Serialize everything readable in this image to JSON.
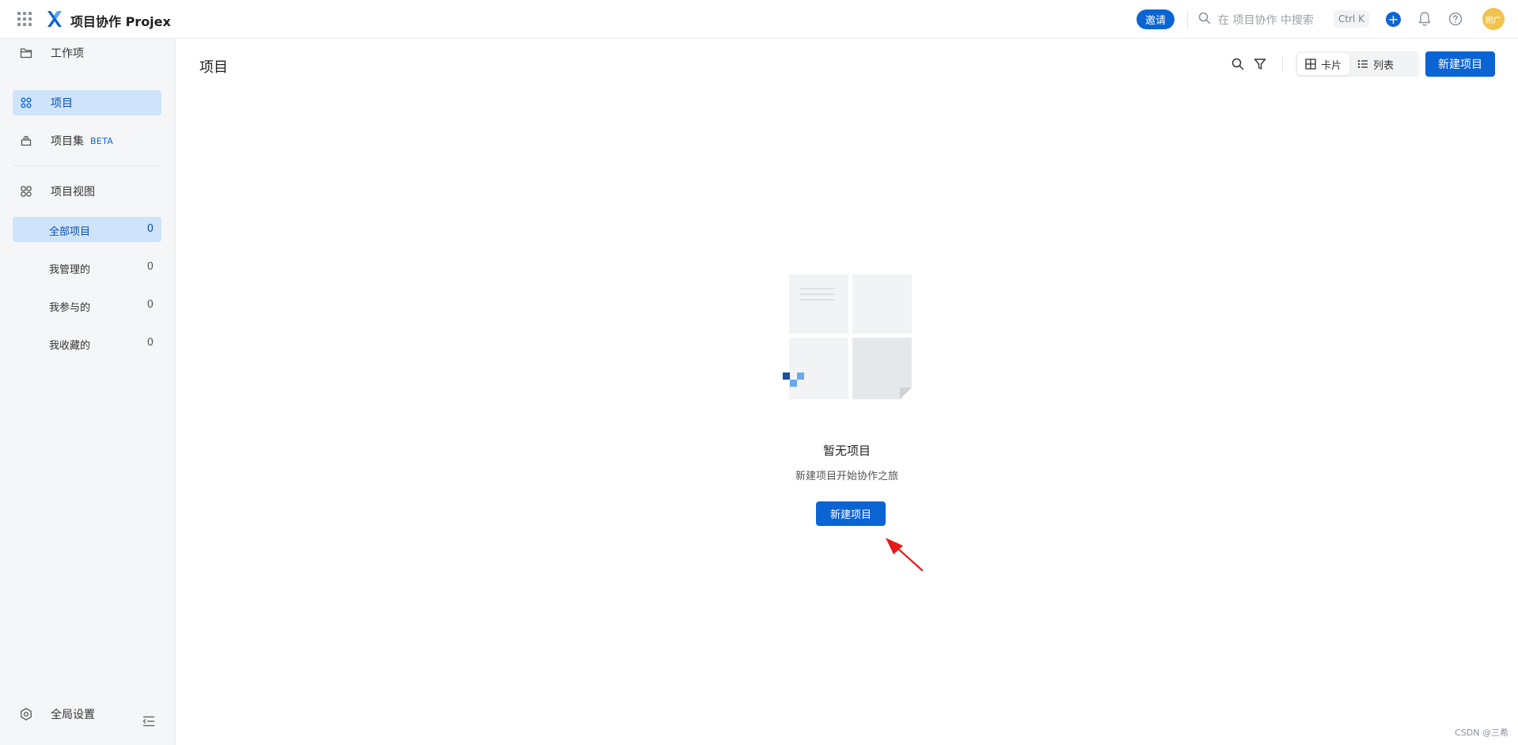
{
  "header": {
    "app_title": "项目协作 Projex",
    "invite_label": "邀请",
    "search_placeholder": "在 项目协作 中搜索",
    "shortcut": "Ctrl K",
    "plus_label": "+",
    "avatar_text": "刚广"
  },
  "sidebar": {
    "items": [
      {
        "label": "工作项",
        "icon": "folder-icon"
      },
      {
        "label": "项目",
        "icon": "grid-icon"
      },
      {
        "label": "项目集",
        "icon": "stack-icon",
        "badge": "BETA"
      }
    ],
    "views_title": "项目视图",
    "views": [
      {
        "label": "全部项目",
        "count": "0"
      },
      {
        "label": "我管理的",
        "count": "0"
      },
      {
        "label": "我参与的",
        "count": "0"
      },
      {
        "label": "我收藏的",
        "count": "0"
      }
    ],
    "settings_label": "全局设置"
  },
  "main": {
    "title": "项目",
    "view_options": [
      "卡片",
      "列表"
    ],
    "new_button": "新建项目",
    "empty": {
      "title": "暂无项目",
      "subtitle": "新建项目开始协作之旅",
      "button": "新建项目"
    }
  },
  "watermark": "CSDN @三希",
  "colors": {
    "accent": "#0b64d3",
    "active_bg": "#cfe4fb",
    "sidebar_bg": "#f5f6f8",
    "avatar": "#f2c34d"
  }
}
